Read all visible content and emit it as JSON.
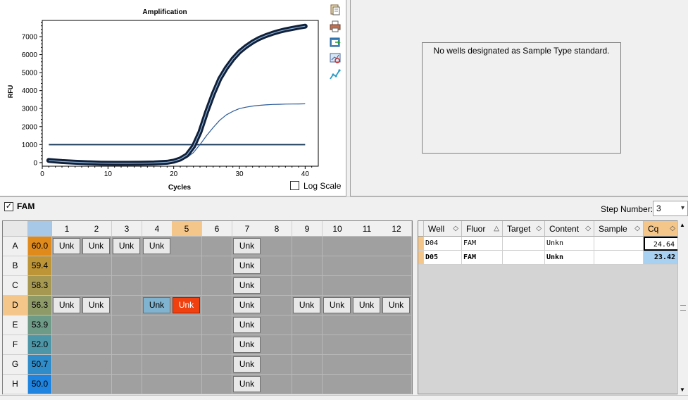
{
  "chart_data": {
    "type": "line",
    "title": "Amplification",
    "xlabel": "Cycles",
    "ylabel": "RFU",
    "xlim": [
      0,
      42
    ],
    "ylim": [
      -200,
      7900
    ],
    "xticks": [
      0,
      10,
      20,
      30,
      40
    ],
    "yticks": [
      0,
      1000,
      2000,
      3000,
      4000,
      5000,
      6000,
      7000
    ],
    "grid": true,
    "threshold": 1000,
    "series": [
      {
        "well": "D05",
        "color": "#1a2a40",
        "highlight": true,
        "x": [
          1,
          3,
          5,
          7,
          9,
          11,
          13,
          15,
          17,
          19,
          20,
          21,
          22,
          23,
          24,
          25,
          26,
          27,
          28,
          29,
          30,
          31,
          32,
          33,
          34,
          35,
          36,
          37,
          38,
          39,
          40
        ],
        "y": [
          120,
          60,
          20,
          -10,
          -30,
          -40,
          -40,
          -35,
          -20,
          20,
          80,
          200,
          420,
          900,
          1700,
          2800,
          3800,
          4650,
          5250,
          5750,
          6150,
          6450,
          6700,
          6900,
          7050,
          7180,
          7290,
          7380,
          7450,
          7520,
          7580
        ]
      },
      {
        "well": "D04",
        "color": "#2a5a9a",
        "highlight": false,
        "x": [
          1,
          3,
          5,
          7,
          9,
          11,
          13,
          15,
          17,
          19,
          20,
          21,
          22,
          23,
          24,
          25,
          26,
          27,
          28,
          29,
          30,
          31,
          32,
          33,
          34,
          35,
          36,
          37,
          38,
          39,
          40
        ],
        "y": [
          100,
          50,
          15,
          -10,
          -25,
          -30,
          -30,
          -25,
          -15,
          15,
          50,
          120,
          280,
          560,
          1000,
          1500,
          1950,
          2350,
          2650,
          2850,
          3000,
          3080,
          3140,
          3180,
          3210,
          3230,
          3240,
          3250,
          3255,
          3260,
          3265
        ]
      }
    ]
  },
  "chart_panel": {
    "log_scale_label": "Log Scale",
    "log_scale_checked": false
  },
  "standard_panel": {
    "message": "No wells designated as Sample Type standard."
  },
  "toolbar_icons": [
    "copy-icon",
    "print-icon",
    "export-icon",
    "zoom-icon",
    "chart-options-icon"
  ],
  "fluor_bar": {
    "fam_label": "FAM",
    "fam_checked": true,
    "step_label": "Step Number:",
    "step_value": "3"
  },
  "plate": {
    "columns": [
      "1",
      "2",
      "3",
      "4",
      "5",
      "6",
      "7",
      "8",
      "9",
      "10",
      "11",
      "12"
    ],
    "rows": [
      {
        "label": "A",
        "temp": "60.0",
        "temp_color": "#e08a1c",
        "wells": [
          "Unk",
          "Unk",
          "Unk",
          "Unk",
          "",
          "",
          "Unk",
          "",
          "",
          "",
          "",
          ""
        ]
      },
      {
        "label": "B",
        "temp": "59.4",
        "temp_color": "#bd9436",
        "wells": [
          "",
          "",
          "",
          "",
          "",
          "",
          "Unk",
          "",
          "",
          "",
          "",
          ""
        ]
      },
      {
        "label": "C",
        "temp": "58.3",
        "temp_color": "#a69850",
        "wells": [
          "",
          "",
          "",
          "",
          "",
          "",
          "Unk",
          "",
          "",
          "",
          "",
          ""
        ]
      },
      {
        "label": "D",
        "temp": "56.3",
        "temp_color": "#8e9a68",
        "wells": [
          "Unk",
          "Unk",
          "",
          "Unk",
          "Unk",
          "",
          "Unk",
          "",
          "Unk",
          "Unk",
          "Unk",
          "Unk"
        ]
      },
      {
        "label": "E",
        "temp": "53.9",
        "temp_color": "#6e9a88",
        "wells": [
          "",
          "",
          "",
          "",
          "",
          "",
          "Unk",
          "",
          "",
          "",
          "",
          ""
        ]
      },
      {
        "label": "F",
        "temp": "52.0",
        "temp_color": "#4c96a8",
        "wells": [
          "",
          "",
          "",
          "",
          "",
          "",
          "Unk",
          "",
          "",
          "",
          "",
          ""
        ]
      },
      {
        "label": "G",
        "temp": "50.7",
        "temp_color": "#2f8cc8",
        "wells": [
          "",
          "",
          "",
          "",
          "",
          "",
          "Unk",
          "",
          "",
          "",
          "",
          ""
        ]
      },
      {
        "label": "H",
        "temp": "50.0",
        "temp_color": "#1e84e0",
        "wells": [
          "",
          "",
          "",
          "",
          "",
          "",
          "Unk",
          "",
          "",
          "",
          "",
          ""
        ]
      }
    ],
    "selected_row": "D",
    "selected_column": "5",
    "highlight_wells": {
      "D4": "#7fb3cf",
      "D5": "#f04010"
    }
  },
  "results_table": {
    "headers": [
      "Well",
      "Fluor",
      "Target",
      "Content",
      "Sample",
      "Cq"
    ],
    "rows": [
      {
        "well": "D04",
        "fluor": "FAM",
        "target": "",
        "content": "Unkn",
        "sample": "",
        "cq": "24.64",
        "bold": false
      },
      {
        "well": "D05",
        "fluor": "FAM",
        "target": "",
        "content": "Unkn",
        "sample": "",
        "cq": "23.42",
        "bold": true
      }
    ]
  }
}
